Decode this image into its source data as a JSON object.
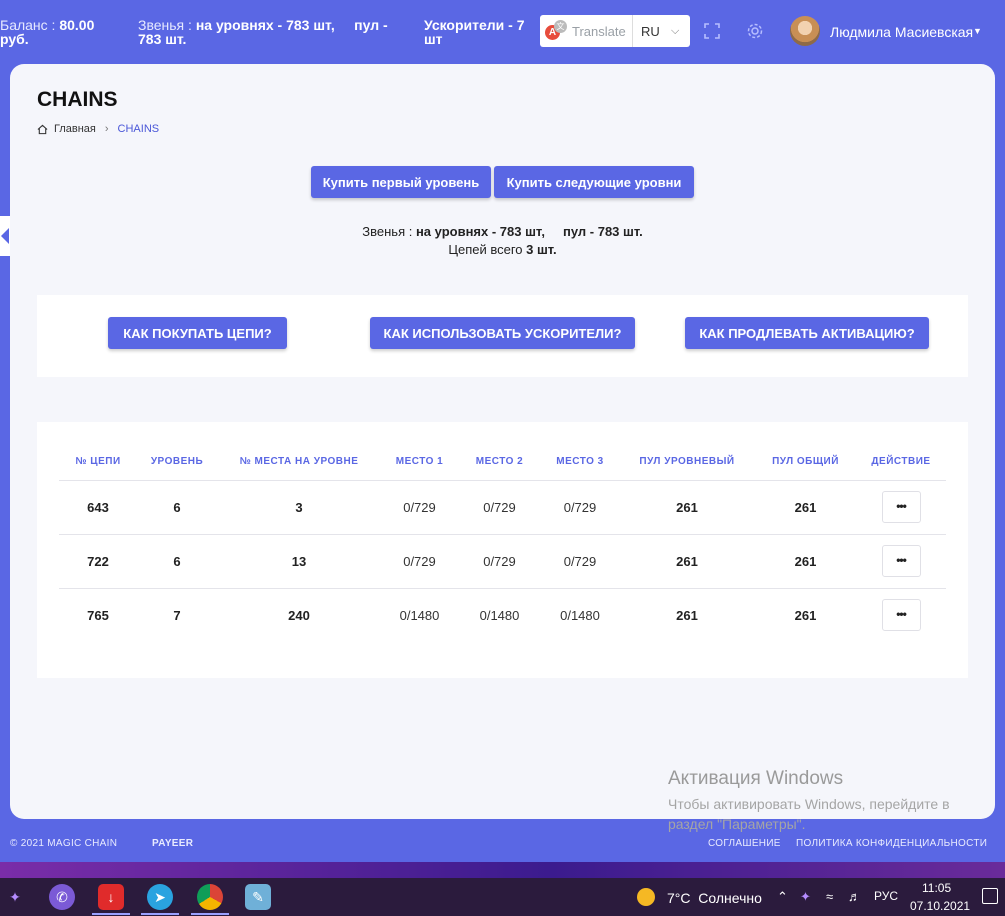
{
  "topbar": {
    "balance_label": "Баланс : ",
    "balance_value": "80.00 руб.",
    "links_label": "Звенья : ",
    "links_value": "на уровнях - 783 шт,     пул - 783 шт.",
    "boosters_label": "Ускорители - 7 шт",
    "translate_label": "Translate",
    "language": "RU",
    "username": "Людмила Масиевская"
  },
  "page": {
    "title": "CHAINS",
    "breadcrumb_home": "Главная",
    "breadcrumb_current": "CHAINS"
  },
  "actions": {
    "buy_first": "Купить первый уровень",
    "buy_next": "Купить следующие уровни"
  },
  "summary": {
    "links_label": "Звенья : ",
    "links_value": "на уровнях - 783 шт,     пул - 783 шт.",
    "chains_label": "Цепей всего ",
    "chains_value": "3 шт."
  },
  "help": {
    "how_buy": "КАК ПОКУПАТЬ ЦЕПИ?",
    "how_boost": "КАК ИСПОЛЬЗОВАТЬ УСКОРИТЕЛИ?",
    "how_extend": "КАК ПРОДЛЕВАТЬ АКТИВАЦИЮ?"
  },
  "table": {
    "headers": [
      "№ ЦЕПИ",
      "УРОВЕНЬ",
      "№ МЕСТА НА УРОВНЕ",
      "МЕСТО 1",
      "МЕСТО 2",
      "МЕСТО 3",
      "ПУЛ УРОВНЕВЫЙ",
      "ПУЛ ОБЩИЙ",
      "ДЕЙСТВИЕ"
    ],
    "rows": [
      {
        "chain": "643",
        "level": "6",
        "place": "3",
        "p1": "0/729",
        "p2": "0/729",
        "p3": "0/729",
        "pool_level": "261",
        "pool_total": "261",
        "action": "•••"
      },
      {
        "chain": "722",
        "level": "6",
        "place": "13",
        "p1": "0/729",
        "p2": "0/729",
        "p3": "0/729",
        "pool_level": "261",
        "pool_total": "261",
        "action": "•••"
      },
      {
        "chain": "765",
        "level": "7",
        "place": "240",
        "p1": "0/1480",
        "p2": "0/1480",
        "p3": "0/1480",
        "pool_level": "261",
        "pool_total": "261",
        "action": "•••"
      }
    ]
  },
  "watermark": {
    "title": "Активация Windows",
    "text": "Чтобы активировать Windows, перейдите в раздел \"Параметры\"."
  },
  "footer": {
    "copyright": "© 2021 MAGIC CHAIN",
    "payeer": "PAYEER",
    "agreement": "СОГЛАШЕНИЕ",
    "privacy": "ПОЛИТИКА КОНФИДЕНЦИАЛЬНОСТИ"
  },
  "taskbar": {
    "weather": "7°C  Солнечно",
    "lang": "РУС",
    "time": "11:05",
    "date": "07.10.2021"
  },
  "colors": {
    "accent": "#5a67e4",
    "card_bg": "#f5f6fb",
    "taskbar": "#2b1b3d"
  }
}
